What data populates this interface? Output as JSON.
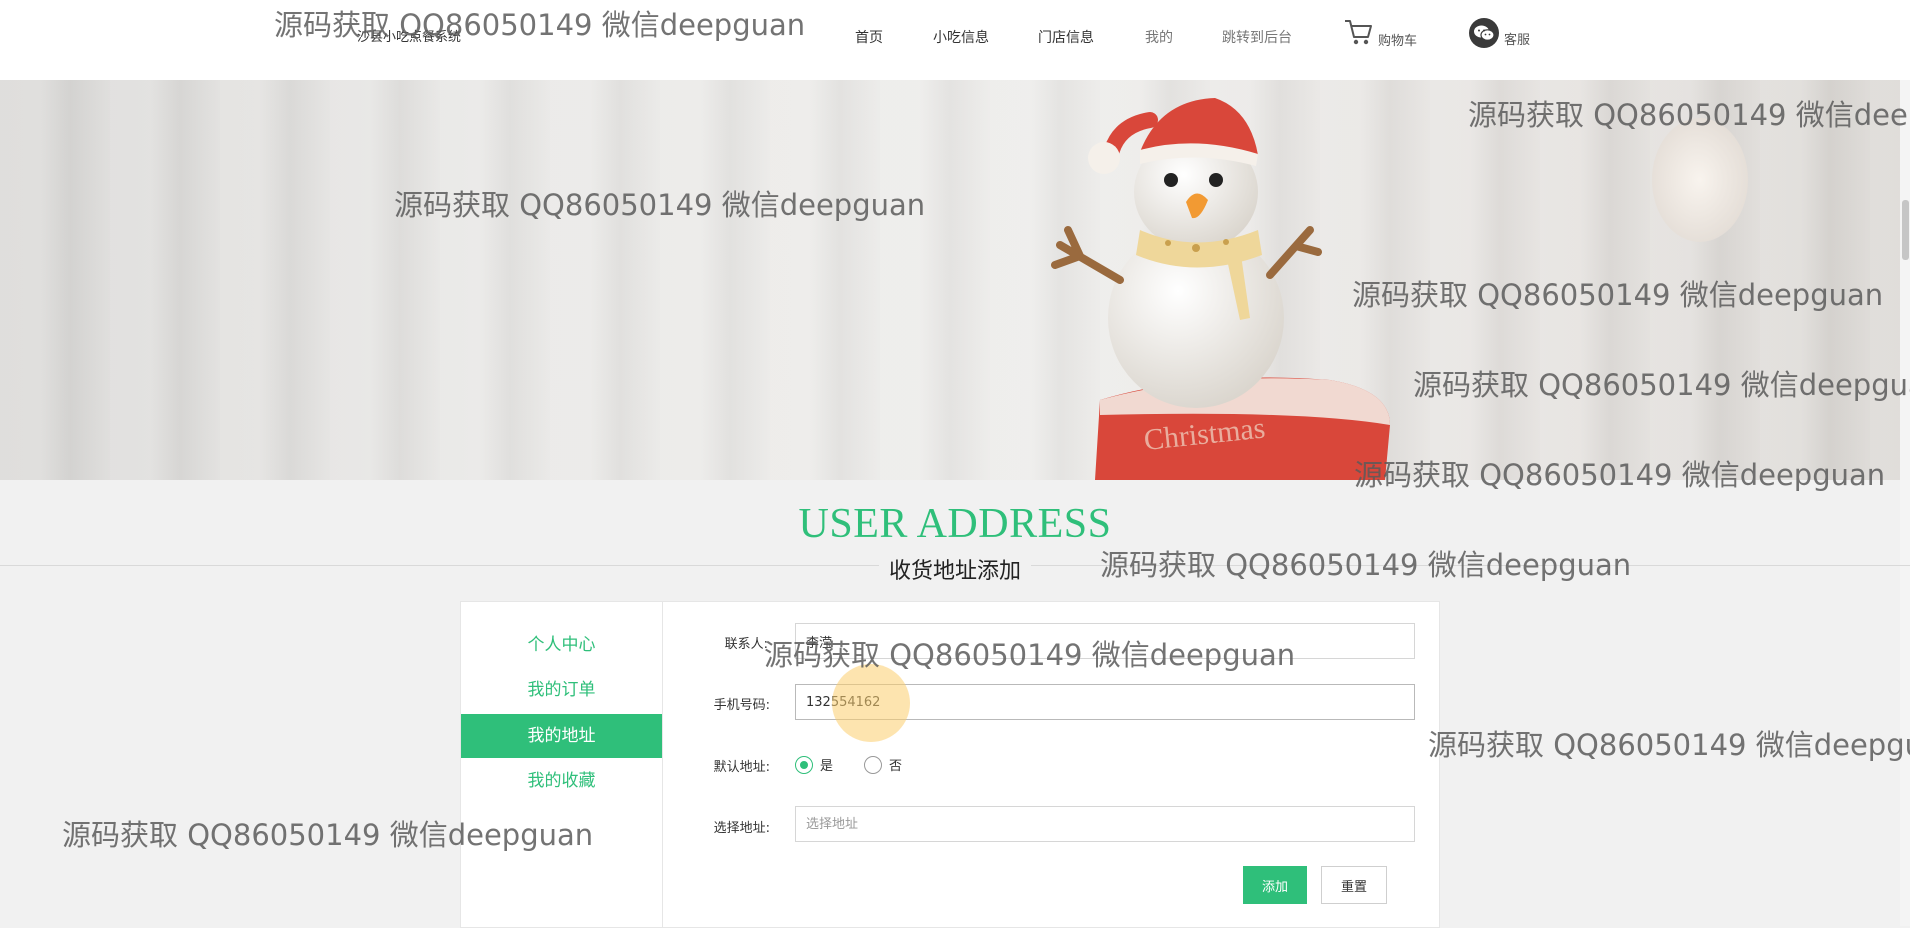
{
  "header": {
    "site_title": "沙县小吃点餐系统",
    "nav": {
      "home": "首页",
      "snack_info": "小吃信息",
      "store_info": "门店信息",
      "mine": "我的",
      "admin": "跳转到后台",
      "cart": "购物车",
      "service": "客服"
    }
  },
  "section": {
    "title": "USER ADDRESS",
    "subtitle": "收货地址添加"
  },
  "sidebar": {
    "items": [
      {
        "label": "个人中心"
      },
      {
        "label": "我的订单"
      },
      {
        "label": "我的地址"
      },
      {
        "label": "我的收藏"
      }
    ],
    "active_index": 2
  },
  "form": {
    "contact_label": "联系人:",
    "contact_value": "李滢",
    "phone_label": "手机号码:",
    "phone_value": "132554162",
    "default_label": "默认地址:",
    "default_yes": "是",
    "default_no": "否",
    "default_selected": "是",
    "address_label": "选择地址:",
    "address_placeholder": "选择地址",
    "submit_label": "添加",
    "reset_label": "重置"
  },
  "watermark_text": "源码获取 QQ86050149 微信deepguan",
  "colors": {
    "accent": "#2fbf7a",
    "watermark": "#5a5a5a"
  }
}
